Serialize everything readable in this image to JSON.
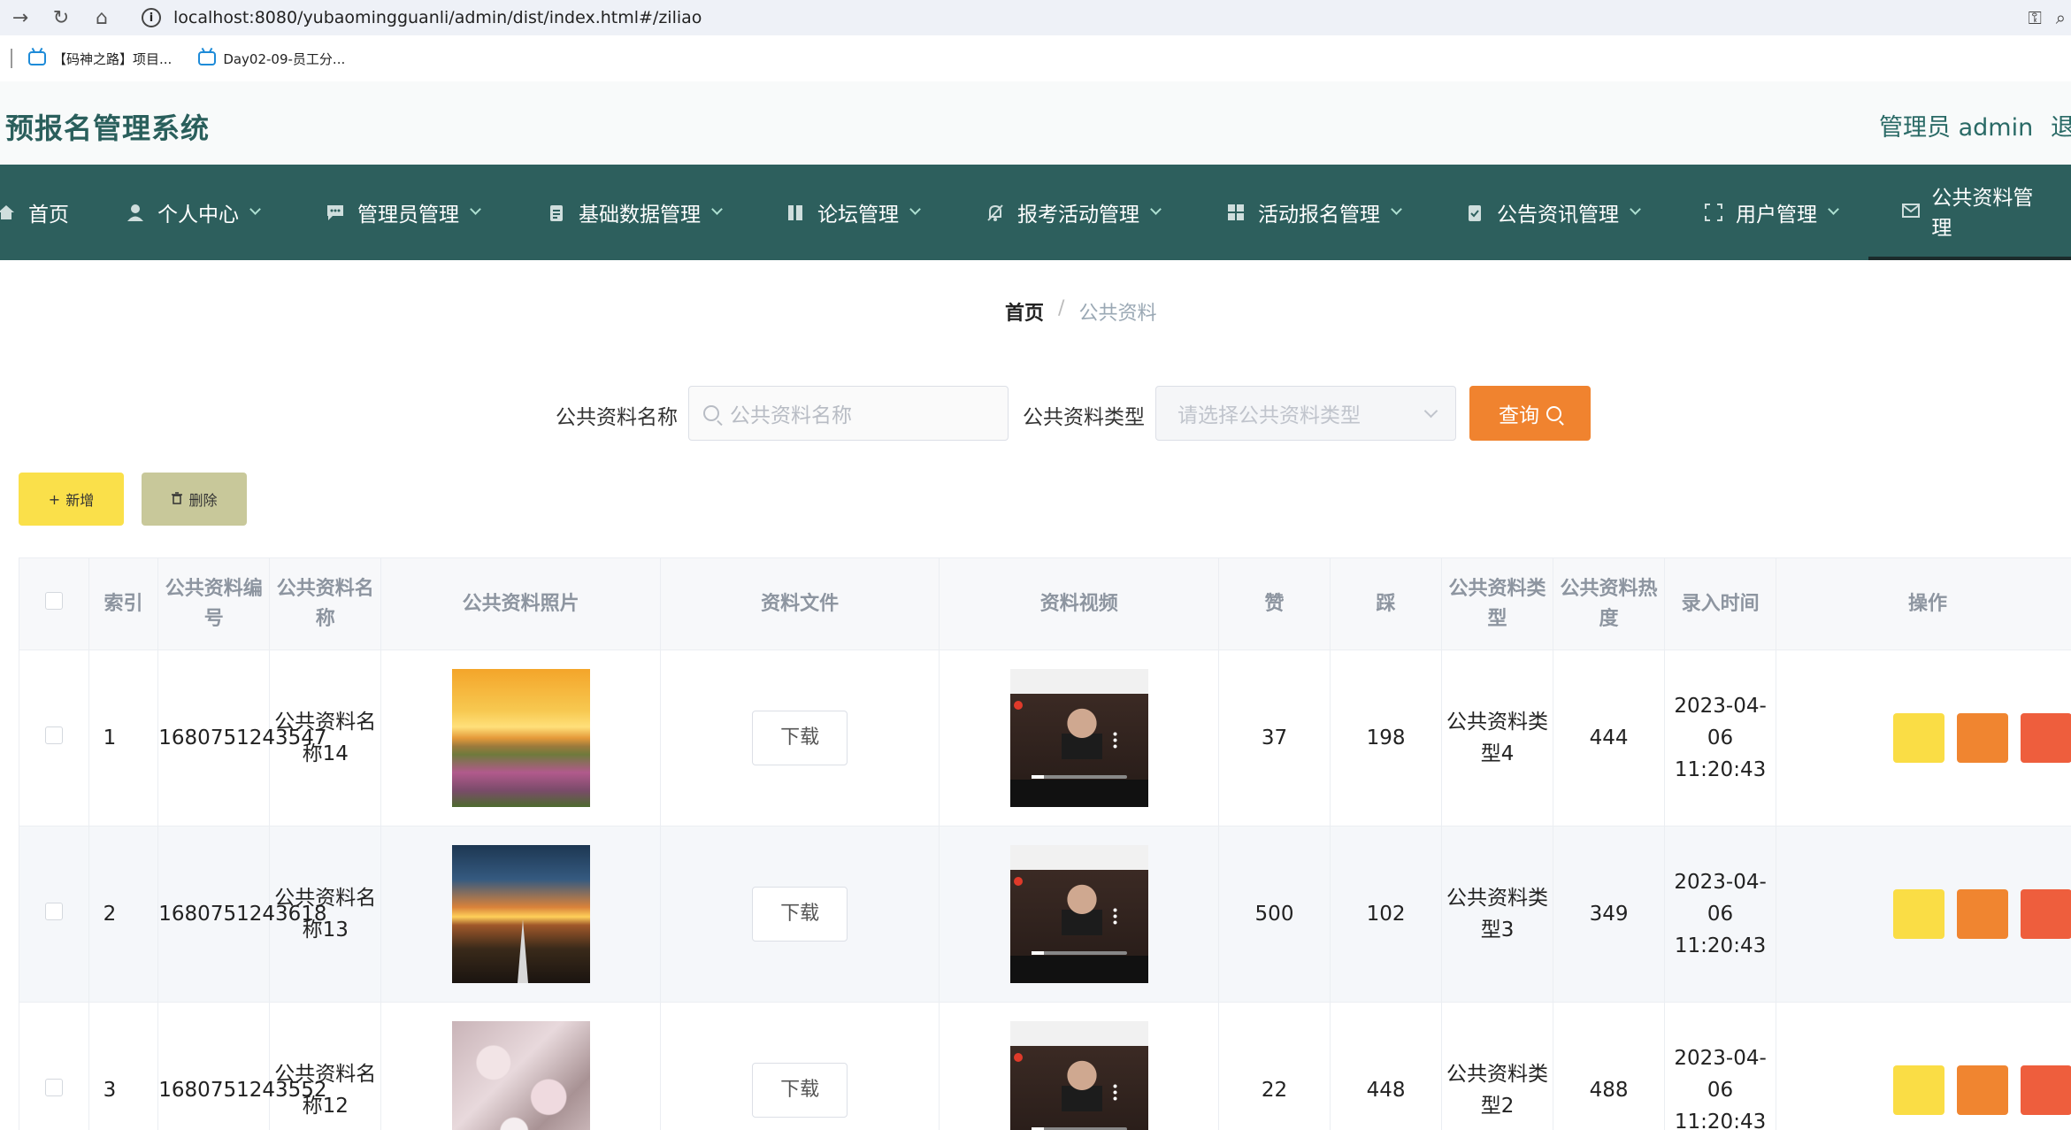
{
  "browser": {
    "url": "localhost:8080/yubaomingguanli/admin/dist/index.html#/ziliao",
    "bookmarks": [
      {
        "label": "【码神之路】项目..."
      },
      {
        "label": "Day02-09-员工分..."
      }
    ]
  },
  "header": {
    "title": "预报名管理系统",
    "admin": "管理员 admin",
    "logout": "退"
  },
  "nav": {
    "items": [
      {
        "label": "首页",
        "icon": "home-icon"
      },
      {
        "label": "个人中心",
        "icon": "user-icon"
      },
      {
        "label": "管理员管理",
        "icon": "chat-icon"
      },
      {
        "label": "基础数据管理",
        "icon": "clipboard-icon"
      },
      {
        "label": "论坛管理",
        "icon": "book-icon"
      },
      {
        "label": "报考活动管理",
        "icon": "bell-off-icon"
      },
      {
        "label": "活动报名管理",
        "icon": "grid-icon"
      },
      {
        "label": "公告资讯管理",
        "icon": "check-clipboard-icon"
      },
      {
        "label": "用户管理",
        "icon": "frame-icon"
      },
      {
        "label": "公共资料管理",
        "icon": "mail-icon"
      }
    ]
  },
  "breadcrumb": {
    "home": "首页",
    "separator": "/",
    "current": "公共资料"
  },
  "search": {
    "name_label": "公共资料名称",
    "name_placeholder": "公共资料名称",
    "type_label": "公共资料类型",
    "type_placeholder": "请选择公共资料类型",
    "query_label": "查询"
  },
  "actions": {
    "add_label": "新增",
    "delete_label": "删除"
  },
  "table": {
    "headers": {
      "index": "索引",
      "code": "公共资料编号",
      "name": "公共资料名称",
      "photo": "公共资料照片",
      "file": "资料文件",
      "video": "资料视频",
      "like": "赞",
      "dislike": "踩",
      "type": "公共资料类型",
      "heat": "公共资料热度",
      "time": "录入时间",
      "ops": "操作"
    },
    "download_label": "下载",
    "rows": [
      {
        "index": "1",
        "code": "1680751243547",
        "name": "公共资料名称14",
        "like": "37",
        "dislike": "198",
        "type": "公共资料类型4",
        "heat": "444",
        "time": "2023-04-06 11:20:43"
      },
      {
        "index": "2",
        "code": "1680751243618",
        "name": "公共资料名称13",
        "like": "500",
        "dislike": "102",
        "type": "公共资料类型3",
        "heat": "349",
        "time": "2023-04-06 11:20:43"
      },
      {
        "index": "3",
        "code": "1680751243552",
        "name": "公共资料名称12",
        "like": "22",
        "dislike": "448",
        "type": "公共资料类型2",
        "heat": "488",
        "time": "2023-04-06 11:20:43"
      }
    ]
  },
  "colors": {
    "nav_bg": "#2d5f5d",
    "title": "#2a5f5c",
    "query": "#f0832f",
    "add": "#fae04a",
    "delete": "#c8c89a",
    "op_view": "#fadd45",
    "op_edit": "#f08530",
    "op_delete": "#ee5e3d"
  }
}
